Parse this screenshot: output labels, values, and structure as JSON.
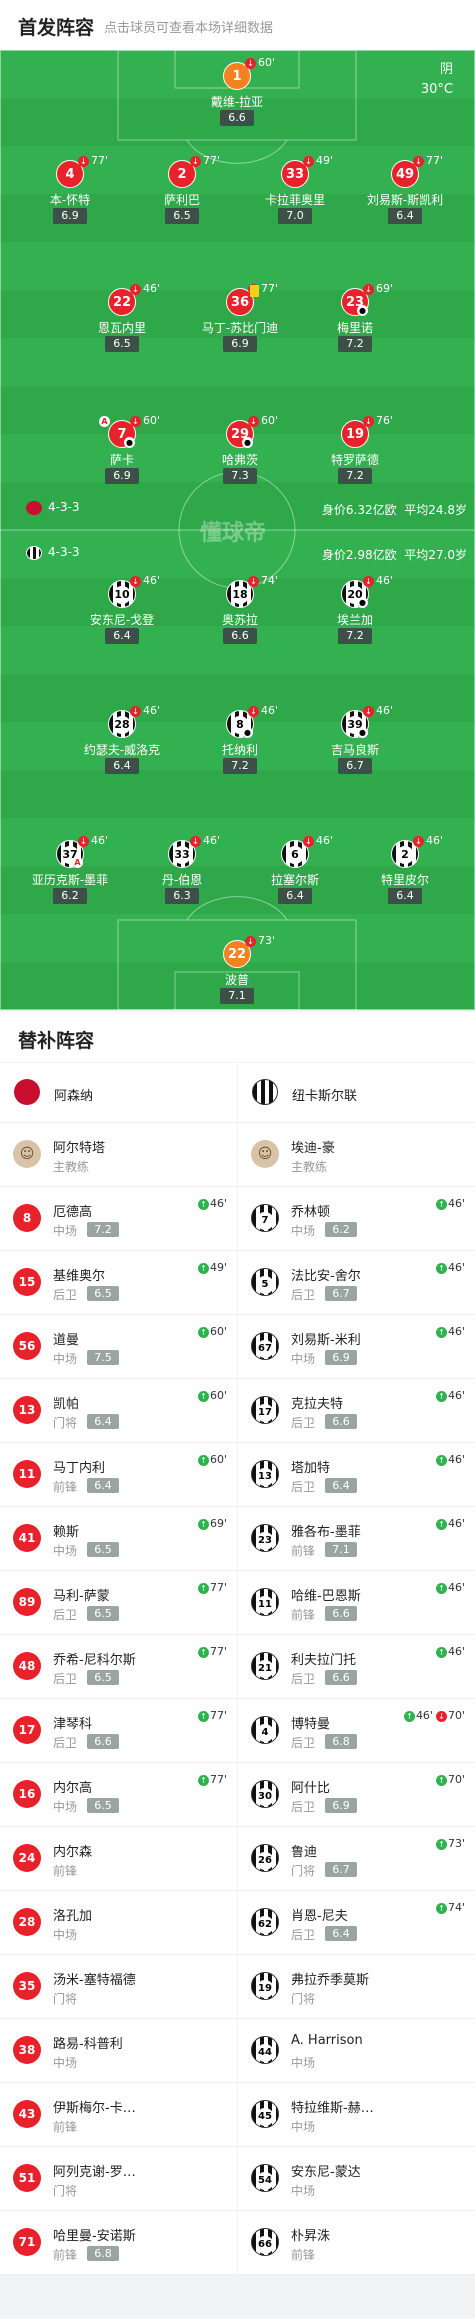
{
  "header": {
    "title": "首发阵容",
    "subtitle": "点击球员可查看本场详细数据"
  },
  "weather": {
    "condition": "阴",
    "temp": "30°C"
  },
  "watermark": "懂球帝",
  "home_info": {
    "formation": "4-3-3",
    "value": "身价6.32亿欧",
    "age": "平均24.8岁"
  },
  "away_info": {
    "formation": "4-3-3",
    "value": "身价2.98亿欧",
    "age": "平均27.0岁"
  },
  "players": [
    {
      "num": "1",
      "name": "戴维-拉亚",
      "rating": "6.6",
      "sub": "60'",
      "kit": "orange"
    },
    {
      "num": "4",
      "name": "本-怀特",
      "rating": "6.9",
      "sub": "77'",
      "kit": "red"
    },
    {
      "num": "2",
      "name": "萨利巴",
      "rating": "6.5",
      "sub": "77'",
      "kit": "red"
    },
    {
      "num": "33",
      "name": "卡拉菲奥里",
      "rating": "7.0",
      "sub": "49'",
      "kit": "red"
    },
    {
      "num": "49",
      "name": "刘易斯-斯凯利",
      "rating": "6.4",
      "sub": "77'",
      "kit": "red"
    },
    {
      "num": "22",
      "name": "恩瓦内里",
      "rating": "6.5",
      "sub": "46'",
      "kit": "red"
    },
    {
      "num": "36",
      "name": "马丁-苏比门迪",
      "rating": "6.9",
      "sub": "77'",
      "kit": "red"
    },
    {
      "num": "23",
      "name": "梅里诺",
      "rating": "7.2",
      "sub": "69'",
      "kit": "red"
    },
    {
      "num": "7",
      "name": "萨卡",
      "rating": "6.9",
      "sub": "60'",
      "kit": "red"
    },
    {
      "num": "29",
      "name": "哈弗茨",
      "rating": "7.3",
      "sub": "60'",
      "kit": "red"
    },
    {
      "num": "19",
      "name": "特罗萨德",
      "rating": "7.2",
      "sub": "76'",
      "kit": "red"
    },
    {
      "num": "10",
      "name": "安东尼-戈登",
      "rating": "6.4",
      "sub": "46'",
      "kit": "stripe"
    },
    {
      "num": "18",
      "name": "奥苏拉",
      "rating": "6.6",
      "sub": "74'",
      "kit": "stripe"
    },
    {
      "num": "20",
      "name": "埃兰加",
      "rating": "7.2",
      "sub": "46'",
      "kit": "stripe"
    },
    {
      "num": "28",
      "name": "约瑟夫-威洛克",
      "rating": "6.4",
      "sub": "46'",
      "kit": "stripe"
    },
    {
      "num": "8",
      "name": "托纳利",
      "rating": "7.2",
      "sub": "46'",
      "kit": "stripe"
    },
    {
      "num": "39",
      "name": "吉马良斯",
      "rating": "6.7",
      "sub": "46'",
      "kit": "stripe"
    },
    {
      "num": "37",
      "name": "亚历克斯-墨菲",
      "rating": "6.2",
      "sub": "46'",
      "kit": "stripe"
    },
    {
      "num": "33",
      "name": "丹-伯恩",
      "rating": "6.3",
      "sub": "46'",
      "kit": "stripe"
    },
    {
      "num": "6",
      "name": "拉塞尔斯",
      "rating": "6.4",
      "sub": "46'",
      "kit": "stripe"
    },
    {
      "num": "2",
      "name": "特里皮尔",
      "rating": "6.4",
      "sub": "46'",
      "kit": "stripe"
    },
    {
      "num": "22",
      "name": "波普",
      "rating": "7.1",
      "sub": "73'",
      "kit": "orange"
    }
  ],
  "bench": {
    "title": "替补阵容",
    "home": {
      "team": "阿森纳",
      "coach": "阿尔特塔",
      "coach_role": "主教练",
      "players": [
        {
          "num": "8",
          "name": "厄德高",
          "pos": "中场",
          "rating": "7.2",
          "event": "46'"
        },
        {
          "num": "15",
          "name": "基维奥尔",
          "pos": "后卫",
          "rating": "6.5",
          "event": "49'"
        },
        {
          "num": "56",
          "name": "道曼",
          "pos": "中场",
          "rating": "7.5",
          "event": "60'"
        },
        {
          "num": "13",
          "name": "凯帕",
          "pos": "门将",
          "rating": "6.4",
          "event": "60'"
        },
        {
          "num": "11",
          "name": "马丁内利",
          "pos": "前锋",
          "rating": "6.4",
          "event": "60'"
        },
        {
          "num": "41",
          "name": "赖斯",
          "pos": "中场",
          "rating": "6.5",
          "event": "69'"
        },
        {
          "num": "89",
          "name": "马利-萨蒙",
          "pos": "后卫",
          "rating": "6.5",
          "event": "77'"
        },
        {
          "num": "48",
          "name": "乔希-尼科尔斯",
          "pos": "后卫",
          "rating": "6.5",
          "event": "77'"
        },
        {
          "num": "17",
          "name": "津琴科",
          "pos": "后卫",
          "rating": "6.6",
          "event": "77'"
        },
        {
          "num": "16",
          "name": "内尔高",
          "pos": "中场",
          "rating": "6.5",
          "event": "77'"
        },
        {
          "num": "24",
          "name": "内尔森",
          "pos": "前锋",
          "rating": "",
          "event": ""
        },
        {
          "num": "28",
          "name": "洛孔加",
          "pos": "中场",
          "rating": "",
          "event": ""
        },
        {
          "num": "35",
          "name": "汤米-塞特福德",
          "pos": "门将",
          "rating": "",
          "event": ""
        },
        {
          "num": "38",
          "name": "路易-科普利",
          "pos": "中场",
          "rating": "",
          "event": ""
        },
        {
          "num": "43",
          "name": "伊斯梅尔-卡…",
          "pos": "前锋",
          "rating": "",
          "event": ""
        },
        {
          "num": "51",
          "name": "阿列克谢-罗…",
          "pos": "门将",
          "rating": "",
          "event": ""
        },
        {
          "num": "71",
          "name": "哈里曼-安诺斯",
          "pos": "前锋",
          "rating": "6.8",
          "event": ""
        }
      ]
    },
    "away": {
      "team": "纽卡斯尔联",
      "coach": "埃迪-豪",
      "coach_role": "主教练",
      "players": [
        {
          "num": "7",
          "name": "乔林顿",
          "pos": "中场",
          "rating": "6.2",
          "event": "46'"
        },
        {
          "num": "5",
          "name": "法比安-舍尔",
          "pos": "后卫",
          "rating": "6.7",
          "event": "46'"
        },
        {
          "num": "67",
          "name": "刘易斯-米利",
          "pos": "中场",
          "rating": "6.9",
          "event": "46'"
        },
        {
          "num": "17",
          "name": "克拉夫特",
          "pos": "后卫",
          "rating": "6.6",
          "event": "46'"
        },
        {
          "num": "13",
          "name": "塔加特",
          "pos": "后卫",
          "rating": "6.4",
          "event": "46'"
        },
        {
          "num": "23",
          "name": "雅各布-墨菲",
          "pos": "前锋",
          "rating": "7.1",
          "event": "46'"
        },
        {
          "num": "11",
          "name": "哈维-巴恩斯",
          "pos": "前锋",
          "rating": "6.6",
          "event": "46'"
        },
        {
          "num": "21",
          "name": "利夫拉门托",
          "pos": "后卫",
          "rating": "6.6",
          "event": "46'"
        },
        {
          "num": "4",
          "name": "博特曼",
          "pos": "后卫",
          "rating": "6.8",
          "event": "46'",
          "event2": "70'"
        },
        {
          "num": "30",
          "name": "阿什比",
          "pos": "后卫",
          "rating": "6.9",
          "event": "70'"
        },
        {
          "num": "26",
          "name": "鲁迪",
          "pos": "门将",
          "rating": "6.7",
          "event": "73'"
        },
        {
          "num": "62",
          "name": "肖恩-尼夫",
          "pos": "后卫",
          "rating": "6.4",
          "event": "74'"
        },
        {
          "num": "19",
          "name": "弗拉乔季莫斯",
          "pos": "门将",
          "rating": "",
          "event": ""
        },
        {
          "num": "44",
          "name": "A. Harrison",
          "pos": "中场",
          "rating": "",
          "event": ""
        },
        {
          "num": "45",
          "name": "特拉维斯-赫…",
          "pos": "中场",
          "rating": "",
          "event": ""
        },
        {
          "num": "54",
          "name": "安东尼-蒙达",
          "pos": "中场",
          "rating": "",
          "event": ""
        },
        {
          "num": "66",
          "name": "朴昇洙",
          "pos": "前锋",
          "rating": "",
          "event": ""
        }
      ]
    }
  },
  "colors": {
    "pitch": "#33b150",
    "arsenal_red": "#e8222a",
    "keeper_orange": "#f58220",
    "sub_in": "#2fb24c"
  }
}
